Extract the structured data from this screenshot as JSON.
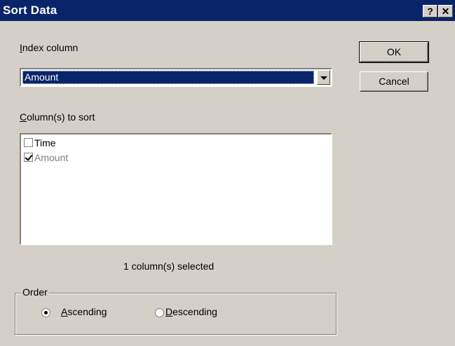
{
  "window": {
    "title": "Sort Data",
    "help_glyph": "?",
    "close_glyph": "✕"
  },
  "index_column": {
    "label_accel": "I",
    "label_rest": "ndex column",
    "selected": "Amount"
  },
  "columns_to_sort": {
    "label_accel": "C",
    "label_rest": "olumn(s) to sort",
    "items": [
      {
        "label": "Time",
        "checked": false,
        "disabled": false
      },
      {
        "label": "Amount",
        "checked": true,
        "disabled": true
      }
    ],
    "status": "1 column(s) selected"
  },
  "buttons": {
    "ok": "OK",
    "cancel": "Cancel"
  },
  "order": {
    "title": "Order",
    "ascending_accel": "A",
    "ascending_rest": "scending",
    "descending_accel": "D",
    "descending_rest": "escending",
    "selected": "ascending"
  },
  "colors": {
    "titlebar": "#0a246a",
    "face": "#d4d0c8",
    "selection": "#0a246a"
  }
}
